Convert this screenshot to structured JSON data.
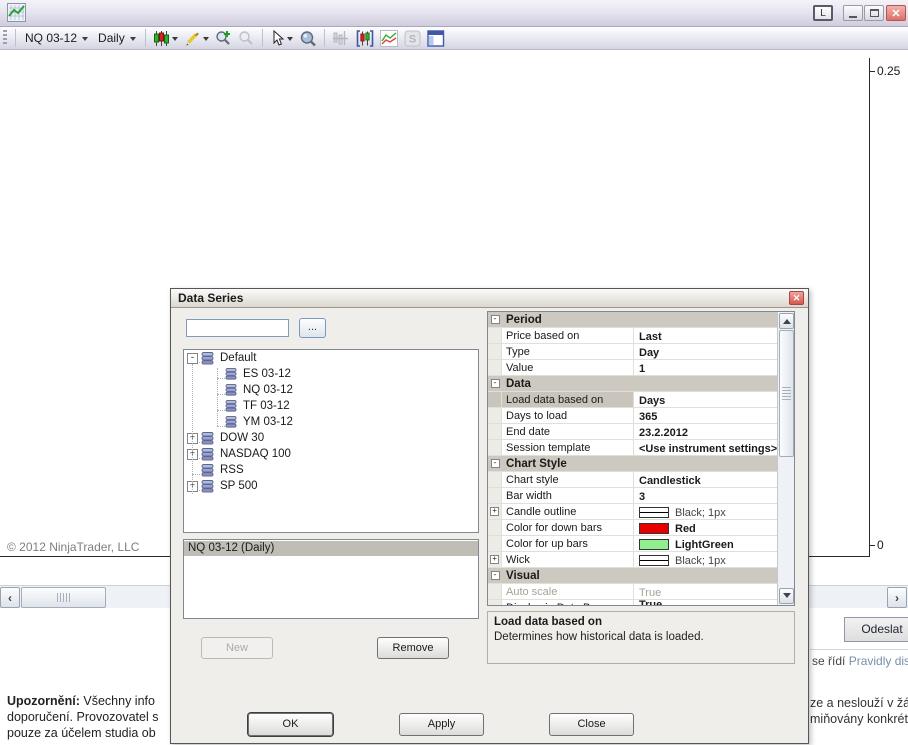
{
  "titlebar": {
    "link_label": "L"
  },
  "toolbar": {
    "instrument": "NQ 03-12",
    "interval": "Daily",
    "icons": [
      "candlestick-series",
      "drawing-tools",
      "zoom-in",
      "zoom-out",
      "pointer",
      "zoom-window",
      "crosshair",
      "data-series",
      "indicators",
      "strategies",
      "chart-panel"
    ]
  },
  "chart": {
    "axis_labels": [
      "0.25",
      "0"
    ],
    "copyright": "© 2012 NinjaTrader, LLC"
  },
  "dialog": {
    "title": "Data Series",
    "instrument_input": {
      "value": "",
      "browse_label": "..."
    },
    "tree": [
      {
        "label": "Default",
        "level": 0,
        "expander": "minus"
      },
      {
        "label": "ES 03-12",
        "level": 1,
        "expander": "none"
      },
      {
        "label": "NQ 03-12",
        "level": 1,
        "expander": "none"
      },
      {
        "label": "TF 03-12",
        "level": 1,
        "expander": "none"
      },
      {
        "label": "YM 03-12",
        "level": 1,
        "expander": "none"
      },
      {
        "label": "DOW 30",
        "level": 0,
        "expander": "plus"
      },
      {
        "label": "NASDAQ 100",
        "level": 0,
        "expander": "plus"
      },
      {
        "label": "RSS",
        "level": 0,
        "expander": "none"
      },
      {
        "label": "SP 500",
        "level": 0,
        "expander": "plus"
      }
    ],
    "series_list": [
      {
        "label": "NQ 03-12 (Daily)",
        "selected": true
      }
    ],
    "buttons": {
      "new": "New",
      "remove": "Remove",
      "ok": "OK",
      "apply": "Apply",
      "close": "Close"
    },
    "properties": [
      {
        "kind": "header",
        "label": "Period"
      },
      {
        "kind": "row",
        "label": "Price based on",
        "value": "Last"
      },
      {
        "kind": "row",
        "label": "Type",
        "value": "Day"
      },
      {
        "kind": "row",
        "label": "Value",
        "value": "1"
      },
      {
        "kind": "header",
        "label": "Data"
      },
      {
        "kind": "row",
        "label": "Load data based on",
        "value": "Days",
        "selected": true
      },
      {
        "kind": "row",
        "label": "Days to load",
        "value": "365"
      },
      {
        "kind": "row",
        "label": "End date",
        "value": "23.2.2012"
      },
      {
        "kind": "row",
        "label": "Session template",
        "value": "<Use instrument settings>"
      },
      {
        "kind": "header",
        "label": "Chart Style"
      },
      {
        "kind": "row",
        "label": "Chart style",
        "value": "Candlestick"
      },
      {
        "kind": "row",
        "label": "Bar width",
        "value": "3"
      },
      {
        "kind": "row",
        "label": "Candle outline",
        "value": "Black; 1px",
        "swatch": "line",
        "expander": "plus",
        "muted": true
      },
      {
        "kind": "row",
        "label": "Color for down bars",
        "value": "Red",
        "swatch": "red"
      },
      {
        "kind": "row",
        "label": "Color for up bars",
        "value": "LightGreen",
        "swatch": "lightgreen"
      },
      {
        "kind": "row",
        "label": "Wick",
        "value": "Black; 1px",
        "swatch": "line",
        "expander": "plus",
        "muted": true
      },
      {
        "kind": "header",
        "label": "Visual"
      },
      {
        "kind": "row",
        "label": "Auto scale",
        "value": "True",
        "disabled": true
      },
      {
        "kind": "row",
        "label": "Display in Data Box",
        "value": "True",
        "partial": true
      }
    ],
    "description": {
      "title": "Load data based on",
      "text": "Determines how historical data is loaded."
    }
  },
  "page": {
    "send_button": "Odeslat",
    "rules_prefix": "se řídí ",
    "rules_link": "Pravidly disku",
    "warning_label": "Upozornění:",
    "warning_line1": " Všechny info",
    "warning_line2": "doporučení. Provozovatel s",
    "warning_line3": "pouze za účelem studia ob",
    "right_line1": "ze a neslouží v žád",
    "right_line2": "miňovány konkrétn"
  },
  "colors": {
    "down_bar": "#e60000",
    "up_bar": "#90ee90",
    "link": "#7b8dab",
    "close_button": "#d95f55"
  }
}
